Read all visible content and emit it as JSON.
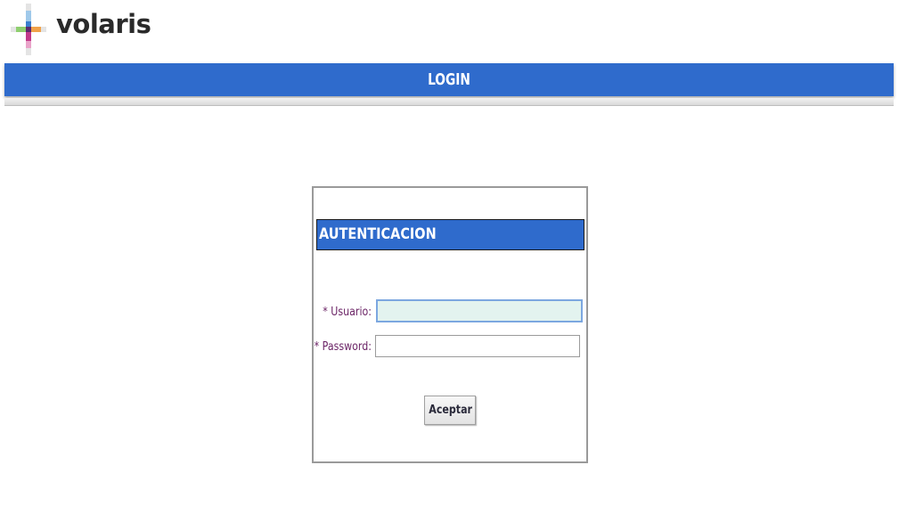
{
  "brand": {
    "name": "volaris"
  },
  "header": {
    "title": "LOGIN",
    "color": "#2f6bcc"
  },
  "auth_panel": {
    "title": "AUTENTICACION",
    "fields": {
      "usuario": {
        "label": "* Usuario:",
        "value": "",
        "placeholder": ""
      },
      "password": {
        "label": "* Password:",
        "value": "",
        "placeholder": ""
      }
    },
    "submit_label": "Aceptar"
  },
  "colors": {
    "primary_blue": "#2f6bcc",
    "label_purple": "#6b2466",
    "focused_input_bg": "#e3f3ef"
  }
}
